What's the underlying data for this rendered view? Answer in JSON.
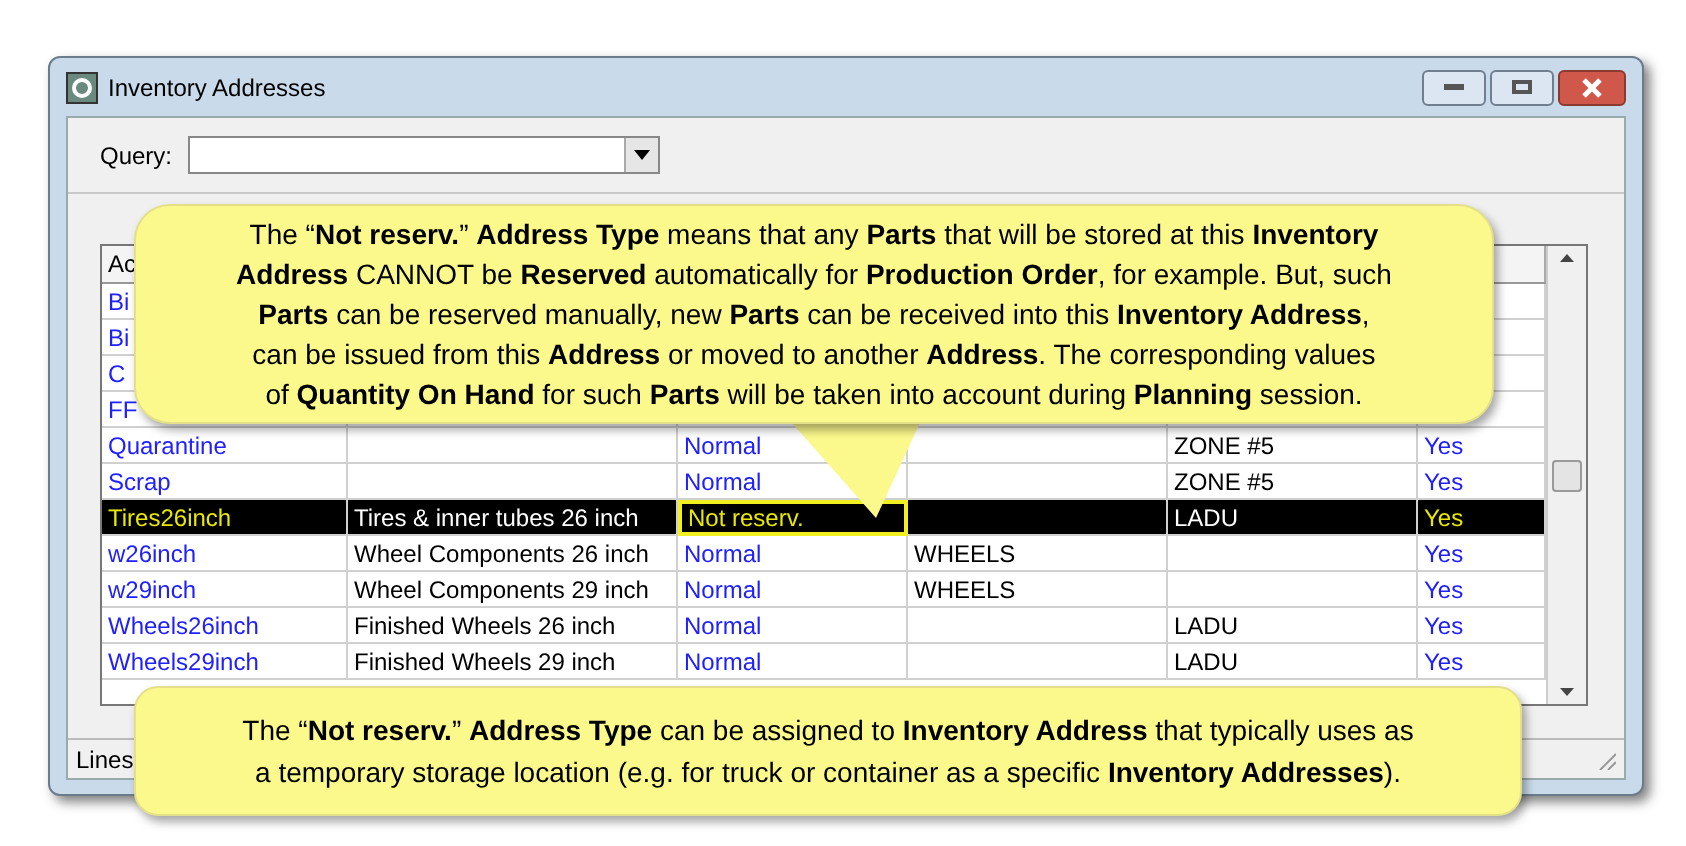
{
  "window": {
    "title": "Inventory Addresses"
  },
  "query": {
    "label": "Query:"
  },
  "table": {
    "header": {
      "column_1": "Ac"
    },
    "rows": [
      {
        "address": "Bi",
        "selected": false
      },
      {
        "address": "Bi",
        "selected": false
      },
      {
        "address": "C",
        "description": "",
        "type": "",
        "column_4": "",
        "column_5": "",
        "column_6": "",
        "selected": false
      },
      {
        "address": "FF",
        "description": "",
        "type": "",
        "column_4": "",
        "column_5": "",
        "column_6": "",
        "selected": false
      },
      {
        "address": "Quarantine",
        "description": "",
        "type": "Normal",
        "column_4": "",
        "column_5": "ZONE #5",
        "column_6": "Yes",
        "selected": false
      },
      {
        "address": "Scrap",
        "description": "",
        "type": "Normal",
        "column_4": "",
        "column_5": "ZONE #5",
        "column_6": "Yes",
        "selected": false
      },
      {
        "address": "Tires26inch",
        "description": "Tires & inner tubes 26 inch",
        "type": "Not reserv.",
        "column_4": "",
        "column_5": "LADU",
        "column_6": "Yes",
        "selected": true
      },
      {
        "address": "w26inch",
        "description": "Wheel Components 26 inch",
        "type": "Normal",
        "column_4": "WHEELS",
        "column_5": "",
        "column_6": "Yes",
        "selected": false
      },
      {
        "address": "w29inch",
        "description": "Wheel Components 29 inch",
        "type": "Normal",
        "column_4": "WHEELS",
        "column_5": "",
        "column_6": "Yes",
        "selected": false
      },
      {
        "address": "Wheels26inch",
        "description": "Finished Wheels 26 inch",
        "type": "Normal",
        "column_4": "",
        "column_5": "LADU",
        "column_6": "Yes",
        "selected": false
      },
      {
        "address": "Wheels29inch",
        "description": "Finished Wheels 29 inch",
        "type": "Normal",
        "column_4": "",
        "column_5": "LADU",
        "column_6": "Yes",
        "selected": false
      }
    ]
  },
  "status_bar": {
    "text": "Lines"
  },
  "callouts": [
    {
      "lines": [
        "The “**Not reserv.**” **Address Type** means that any **Parts** that will be stored at this **Inventory**",
        "**Address** CANNOT be **Reserved** automatically for **Production Order**, for example.  But, such",
        "**Parts** can be reserved manually, new **Parts** can be received into this **Inventory Address**,",
        "can be issued from this **Address** or moved to another **Address**.  The corresponding values",
        "of **Quantity On Hand** for such **Parts** will be taken into account during **Planning** session."
      ]
    },
    {
      "lines": [
        "The “**Not reserv.**” **Address Type** can be assigned to **Inventory Address** that typically uses as",
        "a temporary storage location (e.g. for truck or container as a specific **Inventory Addresses**)."
      ]
    }
  ]
}
